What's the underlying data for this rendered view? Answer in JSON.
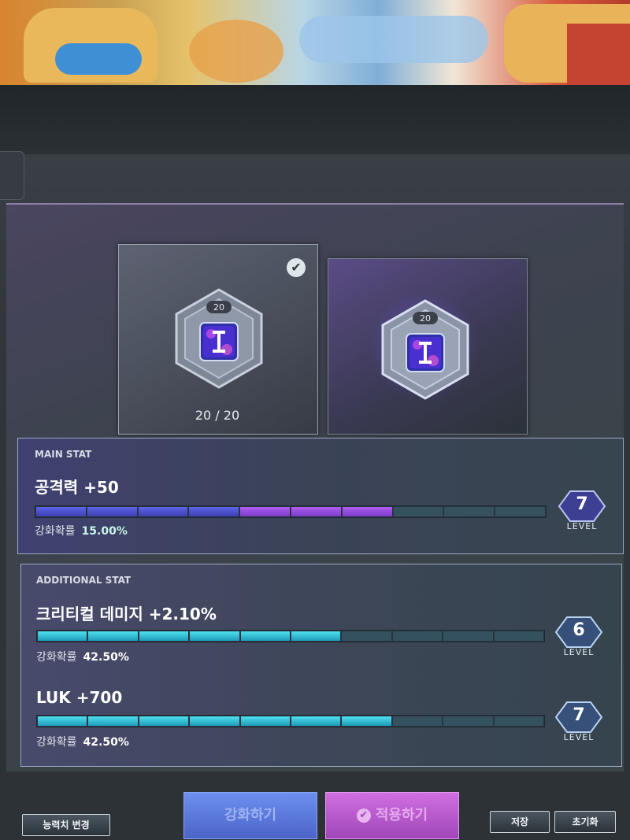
{
  "slots": {
    "current": {
      "badge": "20",
      "count": "20 / 20",
      "checked": true
    },
    "preview": {
      "badge": "20"
    }
  },
  "main_stat": {
    "title": "MAIN STAT",
    "name": "공격력 +50",
    "prob_label": "강화확률",
    "prob_value": "15.00%",
    "level": "7",
    "level_label": "LEVEL",
    "progress": 0.7
  },
  "additional_stat": {
    "title": "ADDITIONAL STAT",
    "items": [
      {
        "name": "크리티컬 데미지 +2.10%",
        "prob_label": "강화확률",
        "prob_value": "42.50%",
        "level": "6",
        "level_label": "LEVEL",
        "progress": 0.6
      },
      {
        "name": "LUK +700",
        "prob_label": "강화확률",
        "prob_value": "42.50%",
        "level": "7",
        "level_label": "LEVEL",
        "progress": 0.7
      }
    ]
  },
  "buttons": {
    "enhance": "강화하기",
    "apply": "적용하기",
    "change_ability": "능력치 변경",
    "save": "저장",
    "reset": "초기화"
  },
  "colors": {
    "main_bar": "#5c64e8",
    "main_bar_tip": "#b05bf0",
    "add_bar": "#4fe0f0",
    "enhance_button": "#6d8ff0",
    "apply_button": "#d06ee0"
  },
  "icons": {
    "check": "check-circle-icon",
    "hex_emblem": "hexagon-emblem-icon",
    "level_badge": "hexagon-level-icon"
  }
}
